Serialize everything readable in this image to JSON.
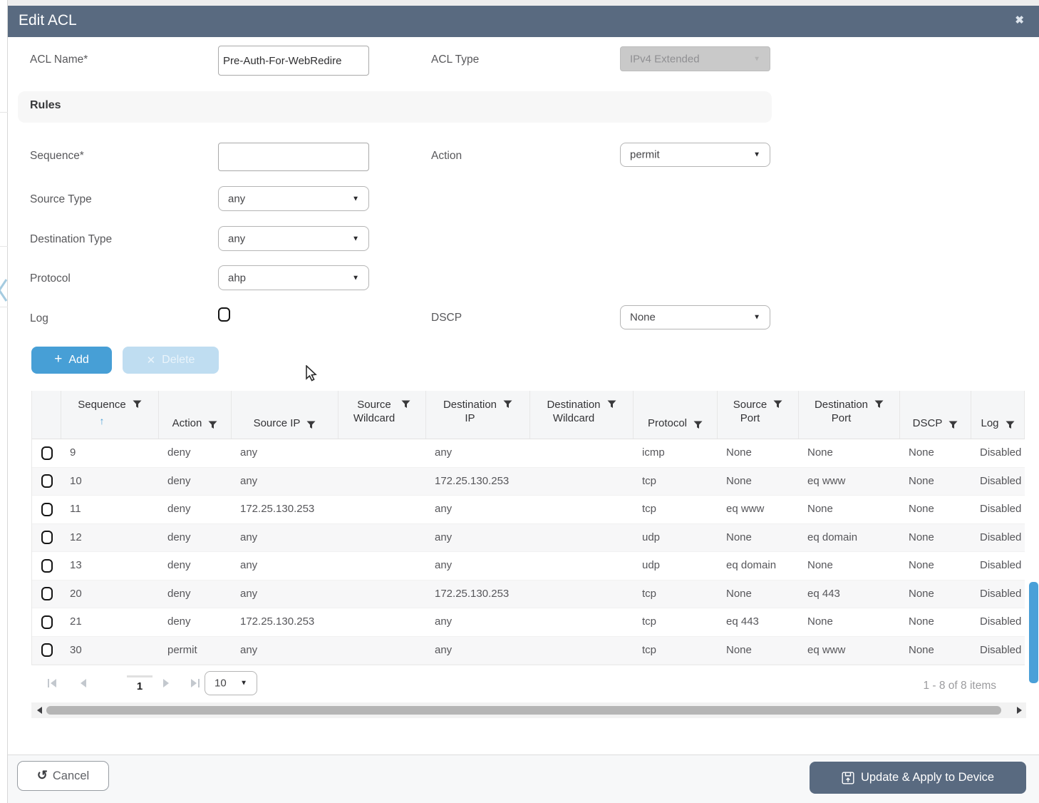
{
  "title": "Edit ACL",
  "close_icon": "x",
  "fields": {
    "acl_name": {
      "label": "ACL Name*",
      "value": "Pre-Auth-For-WebRedire"
    },
    "acl_type": {
      "label": "ACL Type",
      "value": "IPv4 Extended"
    },
    "rules_title": "Rules",
    "sequence": {
      "label": "Sequence*",
      "value": ""
    },
    "action": {
      "label": "Action",
      "value": "permit"
    },
    "source_type": {
      "label": "Source Type",
      "value": "any"
    },
    "destination_type": {
      "label": "Destination Type",
      "value": "any"
    },
    "protocol": {
      "label": "Protocol",
      "value": "ahp"
    },
    "log": {
      "label": "Log",
      "checked": false
    },
    "dscp": {
      "label": "DSCP",
      "value": "None"
    }
  },
  "toolbar": {
    "add": "Add",
    "delete": "Delete"
  },
  "table": {
    "columns": [
      {
        "lines": [
          "Sequence"
        ],
        "sort": "asc"
      },
      {
        "lines": [
          "Action"
        ],
        "align": "bottom"
      },
      {
        "lines": [
          "Source IP"
        ],
        "align": "bottom"
      },
      {
        "lines": [
          "Source",
          "Wildcard"
        ]
      },
      {
        "lines": [
          "Destination",
          "IP"
        ]
      },
      {
        "lines": [
          "Destination",
          "Wildcard"
        ]
      },
      {
        "lines": [
          "Protocol"
        ],
        "align": "bottom"
      },
      {
        "lines": [
          "Source",
          "Port"
        ]
      },
      {
        "lines": [
          "Destination",
          "Port"
        ]
      },
      {
        "lines": [
          "DSCP"
        ],
        "align": "bottom"
      },
      {
        "lines": [
          "Log"
        ],
        "align": "bottom"
      }
    ],
    "rows": [
      [
        "9",
        "deny",
        "any",
        "",
        "any",
        "",
        "icmp",
        "None",
        "None",
        "None",
        "Disabled"
      ],
      [
        "10",
        "deny",
        "any",
        "",
        "172.25.130.253",
        "",
        "tcp",
        "None",
        "eq www",
        "None",
        "Disabled"
      ],
      [
        "11",
        "deny",
        "172.25.130.253",
        "",
        "any",
        "",
        "tcp",
        "eq www",
        "None",
        "None",
        "Disabled"
      ],
      [
        "12",
        "deny",
        "any",
        "",
        "any",
        "",
        "udp",
        "None",
        "eq domain",
        "None",
        "Disabled"
      ],
      [
        "13",
        "deny",
        "any",
        "",
        "any",
        "",
        "udp",
        "eq domain",
        "None",
        "None",
        "Disabled"
      ],
      [
        "20",
        "deny",
        "any",
        "",
        "172.25.130.253",
        "",
        "tcp",
        "None",
        "eq 443",
        "None",
        "Disabled"
      ],
      [
        "21",
        "deny",
        "172.25.130.253",
        "",
        "any",
        "",
        "tcp",
        "eq 443",
        "None",
        "None",
        "Disabled"
      ],
      [
        "30",
        "permit",
        "any",
        "",
        "any",
        "",
        "tcp",
        "None",
        "eq www",
        "None",
        "Disabled"
      ]
    ]
  },
  "pagination": {
    "current_page": "1",
    "page_size": "10",
    "range_label": "1 - 8 of 8 items"
  },
  "footer": {
    "cancel": "Cancel",
    "update": "Update & Apply to Device"
  },
  "colors": {
    "titlebar_bg": "#596a80",
    "add_button": "#479fd6",
    "delete_button_disabled": "#bfddf1",
    "sort_arrow": "#4a9ed6",
    "vertical_scroll_thumb": "#4aa0d8",
    "disabled_field_bg": "#c9c9c9"
  }
}
